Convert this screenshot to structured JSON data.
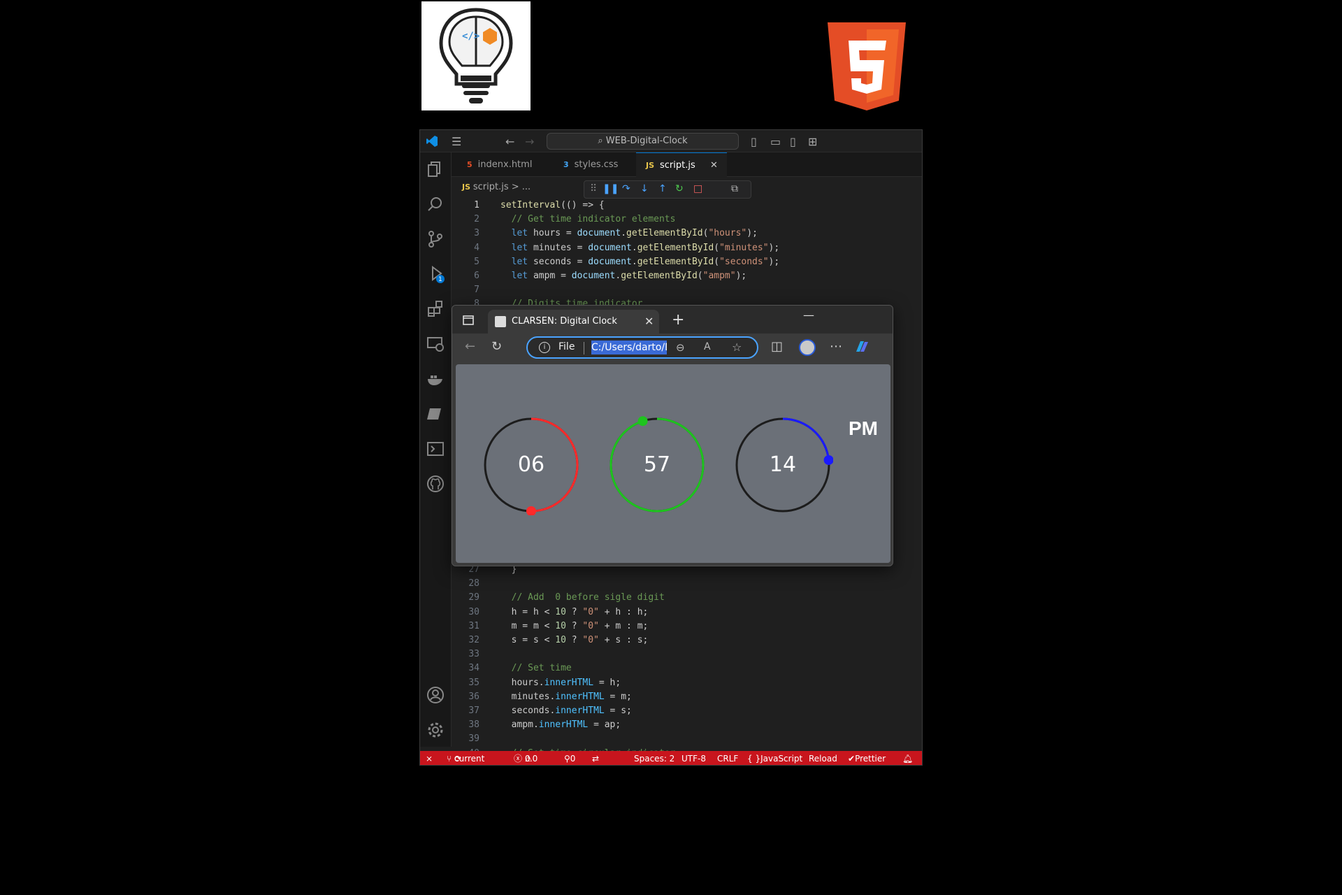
{
  "editor_window": {
    "search_text": "WEB-Digital-Clock",
    "tabs": [
      {
        "label": "indenx.html",
        "icon": "html5-file-icon"
      },
      {
        "label": "styles.css",
        "icon": "css3-file-icon"
      },
      {
        "label": "script.js",
        "icon": "js-file-icon",
        "active": true
      }
    ],
    "breadcrumb": "script.js > ...",
    "code_lines": [
      {
        "n": "1",
        "text": "setInterval(() => {"
      },
      {
        "n": "2",
        "text": "  // Get time indicator elements"
      },
      {
        "n": "3",
        "text": "  let hours = document.getElementById(\"hours\");"
      },
      {
        "n": "4",
        "text": "  let minutes = document.getElementById(\"minutes\");"
      },
      {
        "n": "5",
        "text": "  let seconds = document.getElementById(\"seconds\");"
      },
      {
        "n": "6",
        "text": "  let ampm = document.getElementById(\"ampm\");"
      },
      {
        "n": "7",
        "text": ""
      },
      {
        "n": "8",
        "text": "  // Digits time indicator"
      }
    ],
    "code_lines_bottom": [
      {
        "n": "27",
        "text": "  }"
      },
      {
        "n": "28",
        "text": ""
      },
      {
        "n": "29",
        "text": "  // Add  0 before sigle digit"
      },
      {
        "n": "30",
        "text": "  h = h < 10 ? \"0\" + h : h;"
      },
      {
        "n": "31",
        "text": "  m = m < 10 ? \"0\" + m : m;"
      },
      {
        "n": "32",
        "text": "  s = s < 10 ? \"0\" + s : s;"
      },
      {
        "n": "33",
        "text": ""
      },
      {
        "n": "34",
        "text": "  // Set time"
      },
      {
        "n": "35",
        "text": "  hours.innerHTML = h;"
      },
      {
        "n": "36",
        "text": "  minutes.innerHTML = m;"
      },
      {
        "n": "37",
        "text": "  seconds.innerHTML = s;"
      },
      {
        "n": "38",
        "text": "  ampm.innerHTML = ap;"
      },
      {
        "n": "39",
        "text": ""
      },
      {
        "n": "40",
        "text": "  // Set time circular indicator"
      }
    ],
    "status": {
      "branch": "current",
      "errors": "0",
      "warnings": "0",
      "ports": "0",
      "spaces": "Spaces: 2",
      "encoding": "UTF-8",
      "eol": "CRLF",
      "language": "JavaScript",
      "reload": "Reload",
      "formatter": "Prettier"
    },
    "activity_badge": "1"
  },
  "browser": {
    "tab_title": "CLARSEN: Digital Clock",
    "address_prefix": "File",
    "address_url": "C:/Users/darto/D"
  },
  "clock": {
    "hours": "06",
    "minutes": "57",
    "seconds": "14",
    "ampm": "PM",
    "hours_progress": 0.5,
    "minutes_progress": 0.95,
    "seconds_progress": 0.233,
    "colors": {
      "hours": "#ff2a2a",
      "minutes": "#1ec41e",
      "seconds": "#1a1aff",
      "track": "#1c1c1c"
    }
  },
  "colors": {
    "statusbar": "#c8151d",
    "accent": "#0078d4",
    "html5": "#e44d26",
    "css3": "#264de4",
    "js": "#f0a30a"
  }
}
